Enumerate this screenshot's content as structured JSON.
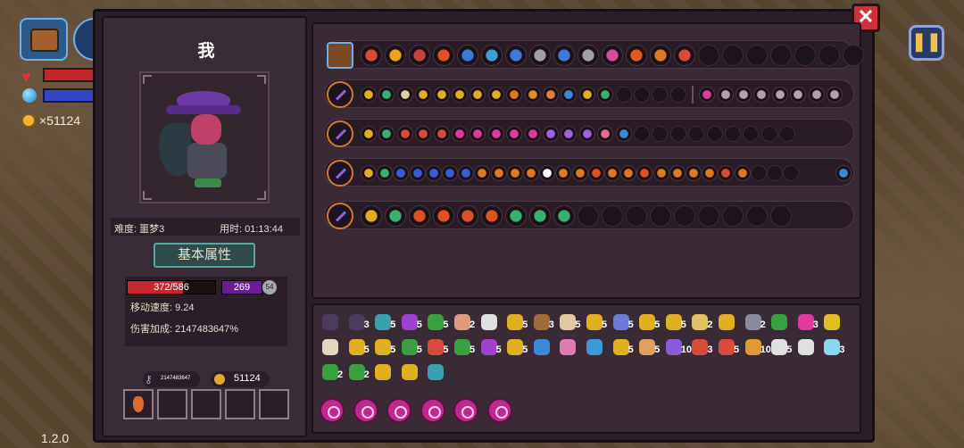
{
  "hud": {
    "coins": "×51124"
  },
  "version": "1.2.0",
  "character": {
    "name": "我",
    "difficulty": "难度: 噩梦3",
    "time": "用时: 01:13:44",
    "attr_title": "基本属性",
    "hp": "372/586",
    "hp_fraction": 0.635,
    "mp": "269",
    "shield": "54",
    "move_speed": "移动速度: 9.24",
    "damage_bonus": "伤害加成: 2147483647%",
    "keys": "2147483647",
    "coins": "51124"
  },
  "weapon_rows": [
    {
      "kind": "chest",
      "colors": [
        "#d84a3a",
        "#f0a020",
        "#c8403a",
        "#e05020",
        "#3a7ad8",
        "#3aa0d8",
        "#3a7ad8",
        "#a0a0a8",
        "#3a7ad8",
        "#a0a0a8",
        "#d84a9a",
        "#e05a20",
        "#e07a20",
        "#d84a3a"
      ],
      "empty": 7
    },
    {
      "kind": "weapon",
      "colors": [
        "#e0b020",
        "#38b070",
        "#e0d0a0",
        "#e0b020",
        "#e0b020",
        "#e0b020",
        "#e0b020",
        "#e0b020",
        "#e07a20",
        "#e09020",
        "#e08040",
        "#3a8ad8",
        "#e0b020",
        "#38b070"
      ],
      "empty": 4,
      "extra": [
        "#e03aa0",
        "#b8a0a8",
        "#b8a0a8",
        "#b8a0a8",
        "#b8a0a8",
        "#b8a0a8",
        "#b8a0a8",
        "#b8a0a8"
      ]
    },
    {
      "kind": "weapon",
      "colors": [
        "#e0b020",
        "#38b070",
        "#d84a3a",
        "#d84a3a",
        "#d84a3a",
        "#e03aa0",
        "#e03aa0",
        "#e03aa0",
        "#e03aa0",
        "#e03aa0",
        "#a060e0",
        "#a060e0",
        "#a060e0",
        "#e07090",
        "#3a8ad8"
      ],
      "empty": 9
    },
    {
      "kind": "weapon",
      "colors": [
        "#e0b020",
        "#38b070",
        "#3a5ad8",
        "#3a5ad8",
        "#3a5ad8",
        "#3a5ad8",
        "#3a5ad8",
        "#e07a20",
        "#e07a20",
        "#e07a20",
        "#e07a20",
        "#ffffff",
        "#e07a20",
        "#e07a20",
        "#e05020",
        "#e07a20",
        "#e07a20",
        "#e05020",
        "#e07a20",
        "#e07a20",
        "#e07a20",
        "#e07a20",
        "#d84a3a",
        "#e07a20"
      ],
      "empty": 3,
      "last": "#3a8ad8"
    },
    {
      "kind": "weapon",
      "colors": [
        "#e0b020",
        "#38b070",
        "#e05020",
        "#e05020",
        "#e05020",
        "#e05020",
        "#38b070",
        "#38b070",
        "#38b070"
      ],
      "empty": 9,
      "big": true
    }
  ],
  "inventory": [
    {
      "c": "#4a3c5a",
      "n": ""
    },
    {
      "c": "#4a3c5a",
      "n": "3"
    },
    {
      "c": "#3aa0b0",
      "n": "5"
    },
    {
      "c": "#a040d0",
      "n": "5"
    },
    {
      "c": "#38a040",
      "n": "5"
    },
    {
      "c": "#e09a7a",
      "n": "2"
    },
    {
      "c": "#e0e0e0",
      "n": ""
    },
    {
      "c": "#e0b020",
      "n": "5"
    },
    {
      "c": "#a06a3a",
      "n": "3"
    },
    {
      "c": "#e0c8a0",
      "n": "5"
    },
    {
      "c": "#e0b020",
      "n": "5"
    },
    {
      "c": "#6a7ad8",
      "n": "5"
    },
    {
      "c": "#e0b020",
      "n": "5"
    },
    {
      "c": "#e0b020",
      "n": "5"
    },
    {
      "c": "#e0c060",
      "n": "2"
    },
    {
      "c": "#e0b020",
      "n": ""
    },
    {
      "c": "#8a8a9a",
      "n": "2"
    },
    {
      "c": "#38a040",
      "n": ""
    },
    {
      "c": "#e03aa0",
      "n": "3"
    },
    {
      "c": "#e0c020",
      "n": ""
    },
    {
      "c": "#e0d8c0",
      "n": ""
    },
    {
      "c": "#e0b020",
      "n": "5"
    },
    {
      "c": "#e0b020",
      "n": "5"
    },
    {
      "c": "#38a040",
      "n": "5"
    },
    {
      "c": "#d84a3a",
      "n": "5"
    },
    {
      "c": "#38a040",
      "n": "5"
    },
    {
      "c": "#a040d0",
      "n": "5"
    },
    {
      "c": "#e0b020",
      "n": "5"
    },
    {
      "c": "#3a8ad8",
      "n": ""
    },
    {
      "c": "#e07ab0",
      "n": ""
    },
    {
      "c": "#3a9ad8",
      "n": ""
    },
    {
      "c": "#e0b020",
      "n": "5"
    },
    {
      "c": "#e0a060",
      "n": "5"
    },
    {
      "c": "#8a5ad8",
      "n": "10"
    },
    {
      "c": "#d84a3a",
      "n": "3"
    },
    {
      "c": "#d84a3a",
      "n": "5"
    },
    {
      "c": "#e09a30",
      "n": "10"
    },
    {
      "c": "#e0e0e0",
      "n": "5"
    },
    {
      "c": "#e0e0e0",
      "n": ""
    },
    {
      "c": "#8ad8f0",
      "n": "3"
    },
    {
      "c": "#38a040",
      "n": "2"
    },
    {
      "c": "#38a040",
      "n": "2"
    },
    {
      "c": "#e0b020",
      "n": ""
    },
    {
      "c": "#e0b020",
      "n": ""
    },
    {
      "c": "#3aa0b0",
      "n": ""
    }
  ],
  "runes": [
    "r1",
    "r2",
    "r3",
    "r4",
    "r5",
    "r6"
  ]
}
